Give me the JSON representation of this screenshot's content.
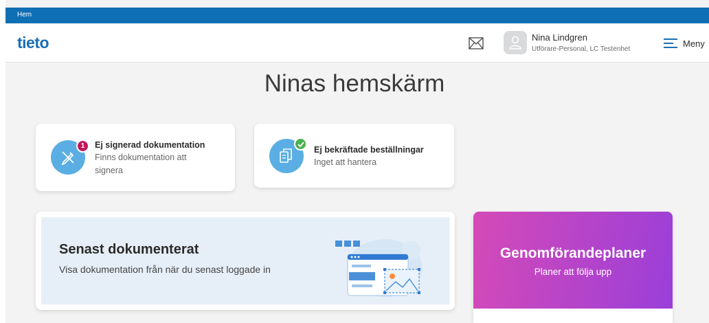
{
  "breadcrumb": {
    "home": "Hem"
  },
  "header": {
    "logo": "tieto",
    "user_name": "Nina Lindgren",
    "user_role": "Utförare-Personal, LC Testenhet",
    "menu_label": "Meny"
  },
  "page": {
    "title": "Ninas hemskärm"
  },
  "cards": {
    "unsigned": {
      "title": "Ej signerad dokumentation",
      "subtitle_line1": "Finns dokumentation att",
      "subtitle_line2": "signera",
      "badge": "1",
      "badge_color": "#c2185b"
    },
    "orders": {
      "title": "Ej bekräftade beställningar",
      "subtitle": "Inget att hantera",
      "badge_color": "#4caf50"
    }
  },
  "latest": {
    "title": "Senast dokumenterat",
    "subtitle": "Visa dokumentation från när du senast loggade in"
  },
  "plans": {
    "title": "Genomförandeplaner",
    "subtitle": "Planer att följa upp"
  },
  "colors": {
    "accent_blue": "#0f6fb4",
    "icon_blue": "#5aaee3",
    "gradient_start": "#d54ab7",
    "gradient_end": "#9a3fd9"
  }
}
